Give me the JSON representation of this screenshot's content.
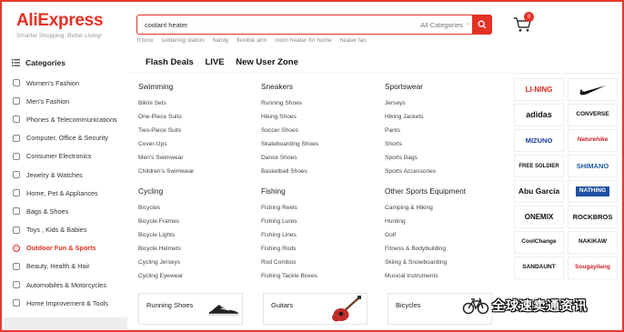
{
  "header": {
    "logo": "AliExpress",
    "tagline": "Smarter Shopping, Better Living!",
    "search": {
      "value": "coolant heater",
      "category": "All Categories"
    },
    "cart_count": "0",
    "hot_searches": [
      "lf brox",
      "soldering station",
      "handy",
      "flexible arm",
      "room heater for home",
      "heater fan"
    ]
  },
  "sidebar": {
    "title": "Categories",
    "items": [
      "Women's Fashion",
      "Men's Fashion",
      "Phones & Telecommunications",
      "Computer, Office & Security",
      "Consumer Electronics",
      "Jewelry & Watches",
      "Home, Pet & Appliances",
      "Bags & Shoes",
      "Toys , Kids & Babies",
      "Outdoor Fun & Sports",
      "Beauty, Health & Hair",
      "Automobiles & Motorcycles",
      "Home Improvement & Tools"
    ],
    "active_index": 9
  },
  "topnav": [
    "Flash Deals",
    "LIVE",
    "New User Zone"
  ],
  "menu": {
    "swimming": {
      "title": "Swimming",
      "links": [
        "Bikini Sets",
        "One-Piece Suits",
        "Two-Piece Suits",
        "Cover-Ups",
        "Men's Swimwear",
        "Children's Swimwear"
      ]
    },
    "sneakers": {
      "title": "Sneakers",
      "links": [
        "Running Shoes",
        "Hiking Shoes",
        "Soccer Shoes",
        "Skateboarding Shoes",
        "Dance Shoes",
        "Basketball Shoes"
      ]
    },
    "sportswear": {
      "title": "Sportswear",
      "links": [
        "Jerseys",
        "Hiking Jackets",
        "Pants",
        "Shorts",
        "Sports Bags",
        "Sports Accessories"
      ]
    },
    "cycling": {
      "title": "Cycling",
      "links": [
        "Bicycles",
        "Bicycle Frames",
        "Bicycle Lights",
        "Bicycle Helmets",
        "Cycling Jerseys",
        "Cycling Eyewear"
      ]
    },
    "fishing": {
      "title": "Fishing",
      "links": [
        "Fishing Reels",
        "Fishing Lures",
        "Fishing Lines",
        "Fishing Rods",
        "Rod Combos",
        "Fishing Tackle Boxes"
      ]
    },
    "other": {
      "title": "Other Sports Equipment",
      "links": [
        "Camping & Hiking",
        "Hunting",
        "Golf",
        "Fitness & Bodybuilding",
        "Skiing & Snowboarding",
        "Musical Instruments"
      ]
    }
  },
  "cards": [
    "Running Shoes",
    "Guitars",
    "Bicycles"
  ],
  "brands": [
    {
      "name": "LI-NING",
      "color": "#d6261c"
    },
    {
      "name": "NIKE",
      "color": "#111111"
    },
    {
      "name": "adidas",
      "color": "#111111"
    },
    {
      "name": "CONVERSE",
      "color": "#111111"
    },
    {
      "name": "MIZUNO",
      "color": "#1f3fa0"
    },
    {
      "name": "Naturehike",
      "color": "#c8202a"
    },
    {
      "name": "FREE SOLDIER",
      "color": "#111111"
    },
    {
      "name": "SHIMANO",
      "color": "#1e5aa8"
    },
    {
      "name": "Abu Garcia",
      "color": "#111111"
    },
    {
      "name": "NATHING",
      "color": "#1e4fa0"
    },
    {
      "name": "ONEMIX",
      "color": "#111111"
    },
    {
      "name": "ROCKBROS",
      "color": "#111111"
    },
    {
      "name": "CoolChange",
      "color": "#111111"
    },
    {
      "name": "NAKIKAW",
      "color": "#111111"
    },
    {
      "name": "SANDAUNT",
      "color": "#111111"
    },
    {
      "name": "Sougayilang",
      "color": "#c8202a"
    }
  ],
  "watermark": "全球速卖通资讯",
  "colors": {
    "brand_red": "#e43225"
  }
}
